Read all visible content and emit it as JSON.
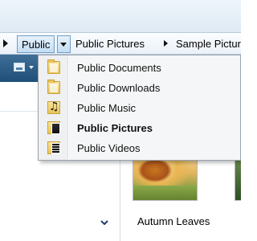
{
  "breadcrumb": {
    "items": [
      {
        "label": "Public"
      },
      {
        "label": "Public Pictures"
      },
      {
        "label": "Sample Pictures"
      }
    ]
  },
  "dropdown_menu": {
    "items": [
      {
        "label": "Public Documents",
        "icon": "folder-icon"
      },
      {
        "label": "Public Downloads",
        "icon": "folder-icon"
      },
      {
        "label": "Public Music",
        "icon": "music-folder-icon"
      },
      {
        "label": "Public Pictures",
        "icon": "pictures-folder-icon",
        "current": true
      },
      {
        "label": "Public Videos",
        "icon": "videos-folder-icon"
      }
    ]
  },
  "content": {
    "items": [
      {
        "label": "Autumn Leaves"
      }
    ]
  },
  "colors": {
    "accent": "#6f9dc3",
    "toolbar": "#2b5b84"
  }
}
